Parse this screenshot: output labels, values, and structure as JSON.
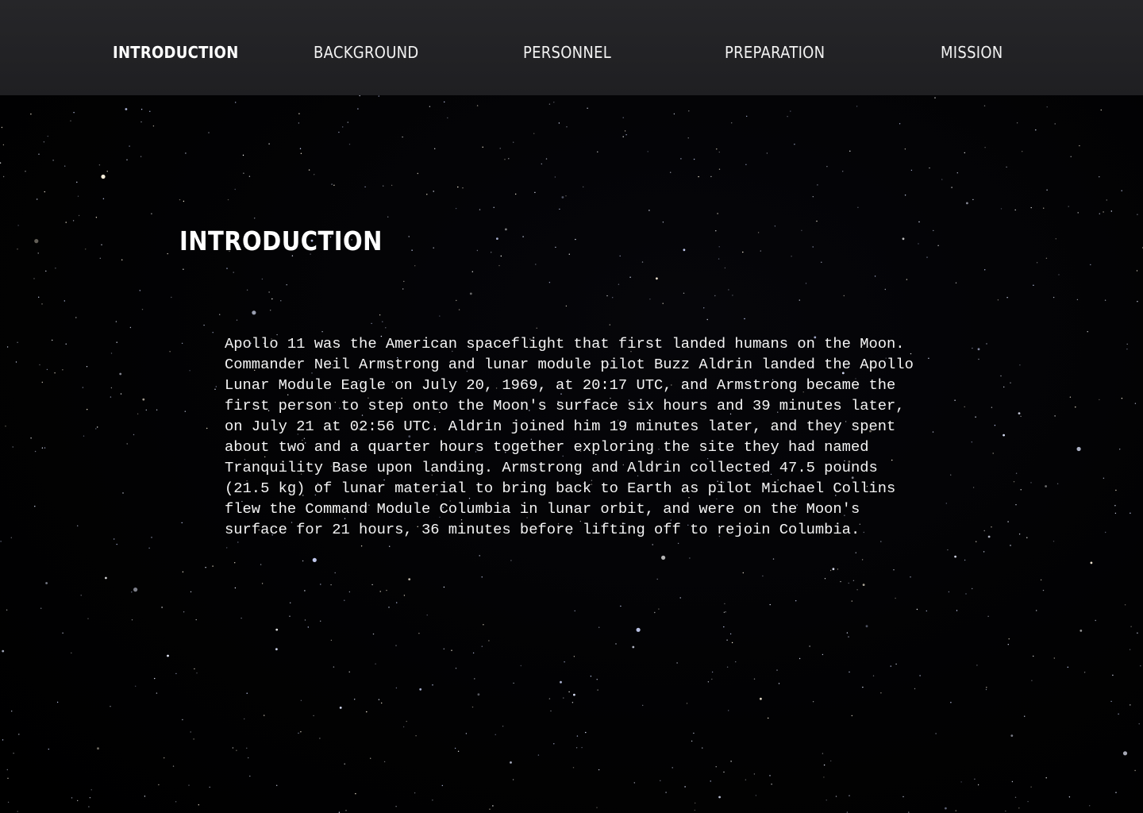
{
  "nav": {
    "items": [
      {
        "label": "INTRODUCTION",
        "active": true
      },
      {
        "label": "BACKGROUND",
        "active": false
      },
      {
        "label": "PERSONNEL",
        "active": false
      },
      {
        "label": "PREPARATION",
        "active": false
      },
      {
        "label": "MISSION",
        "active": false
      }
    ]
  },
  "main": {
    "title": "INTRODUCTION",
    "body": "Apollo 11 was the American spaceflight that first landed humans on the Moon. Commander Neil Armstrong and lunar module pilot Buzz Aldrin landed the Apollo Lunar Module Eagle on July 20, 1969, at 20:17 UTC, and Armstrong became the first person to step onto the Moon's surface six hours and 39 minutes later, on July 21 at 02:56 UTC. Aldrin joined him 19 minutes later, and they spent about two and a quarter hours together exploring the site they had named Tranquility Base upon landing. Armstrong and Aldrin collected 47.5 pounds (21.5 kg) of lunar material to bring back to Earth as pilot Michael Collins flew the Command Module Columbia in lunar orbit, and were on the Moon's surface for 21 hours, 36 minutes before lifting off to rejoin Columbia."
  },
  "colors": {
    "nav_background": "#232326",
    "page_background": "#000000",
    "text": "#ffffff"
  }
}
